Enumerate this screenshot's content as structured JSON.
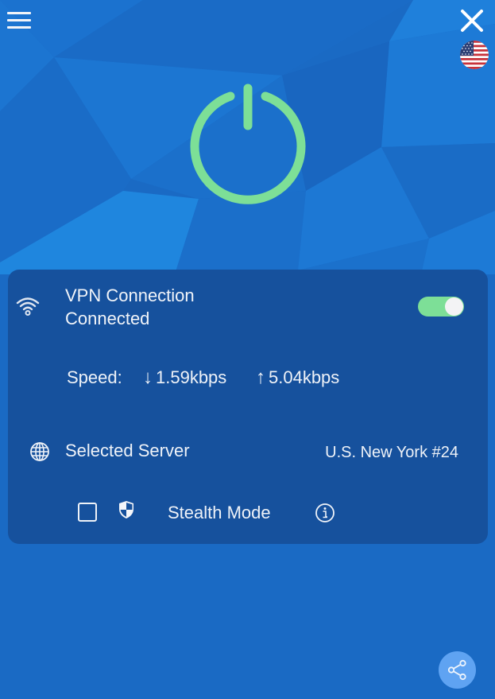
{
  "header": {
    "menu_icon": "hamburger-menu-icon",
    "close_icon": "close-x-icon",
    "country_flag": "us-flag-icon"
  },
  "power": {
    "icon": "power-icon",
    "state": "connected",
    "color": "#7ddf97"
  },
  "connection": {
    "icon": "wifi-icon",
    "title": "VPN Connection",
    "status": "Connected",
    "toggle_on": true
  },
  "speed": {
    "label": "Speed:",
    "download_arrow": "↓",
    "download": "1.59kbps",
    "upload_arrow": "↑",
    "upload": "5.04kbps"
  },
  "server": {
    "icon": "globe-icon",
    "label": "Selected Server",
    "value": "U.S. New York #24"
  },
  "stealth": {
    "checked": false,
    "icon": "shield-icon",
    "label": "Stealth Mode",
    "info_icon": "info-icon"
  },
  "footer": {
    "share_icon": "share-icon"
  },
  "colors": {
    "background": "#1a6ac4",
    "panel": "#16519d",
    "accent_green": "#7ddf97",
    "share_button": "#5fa3f2"
  }
}
